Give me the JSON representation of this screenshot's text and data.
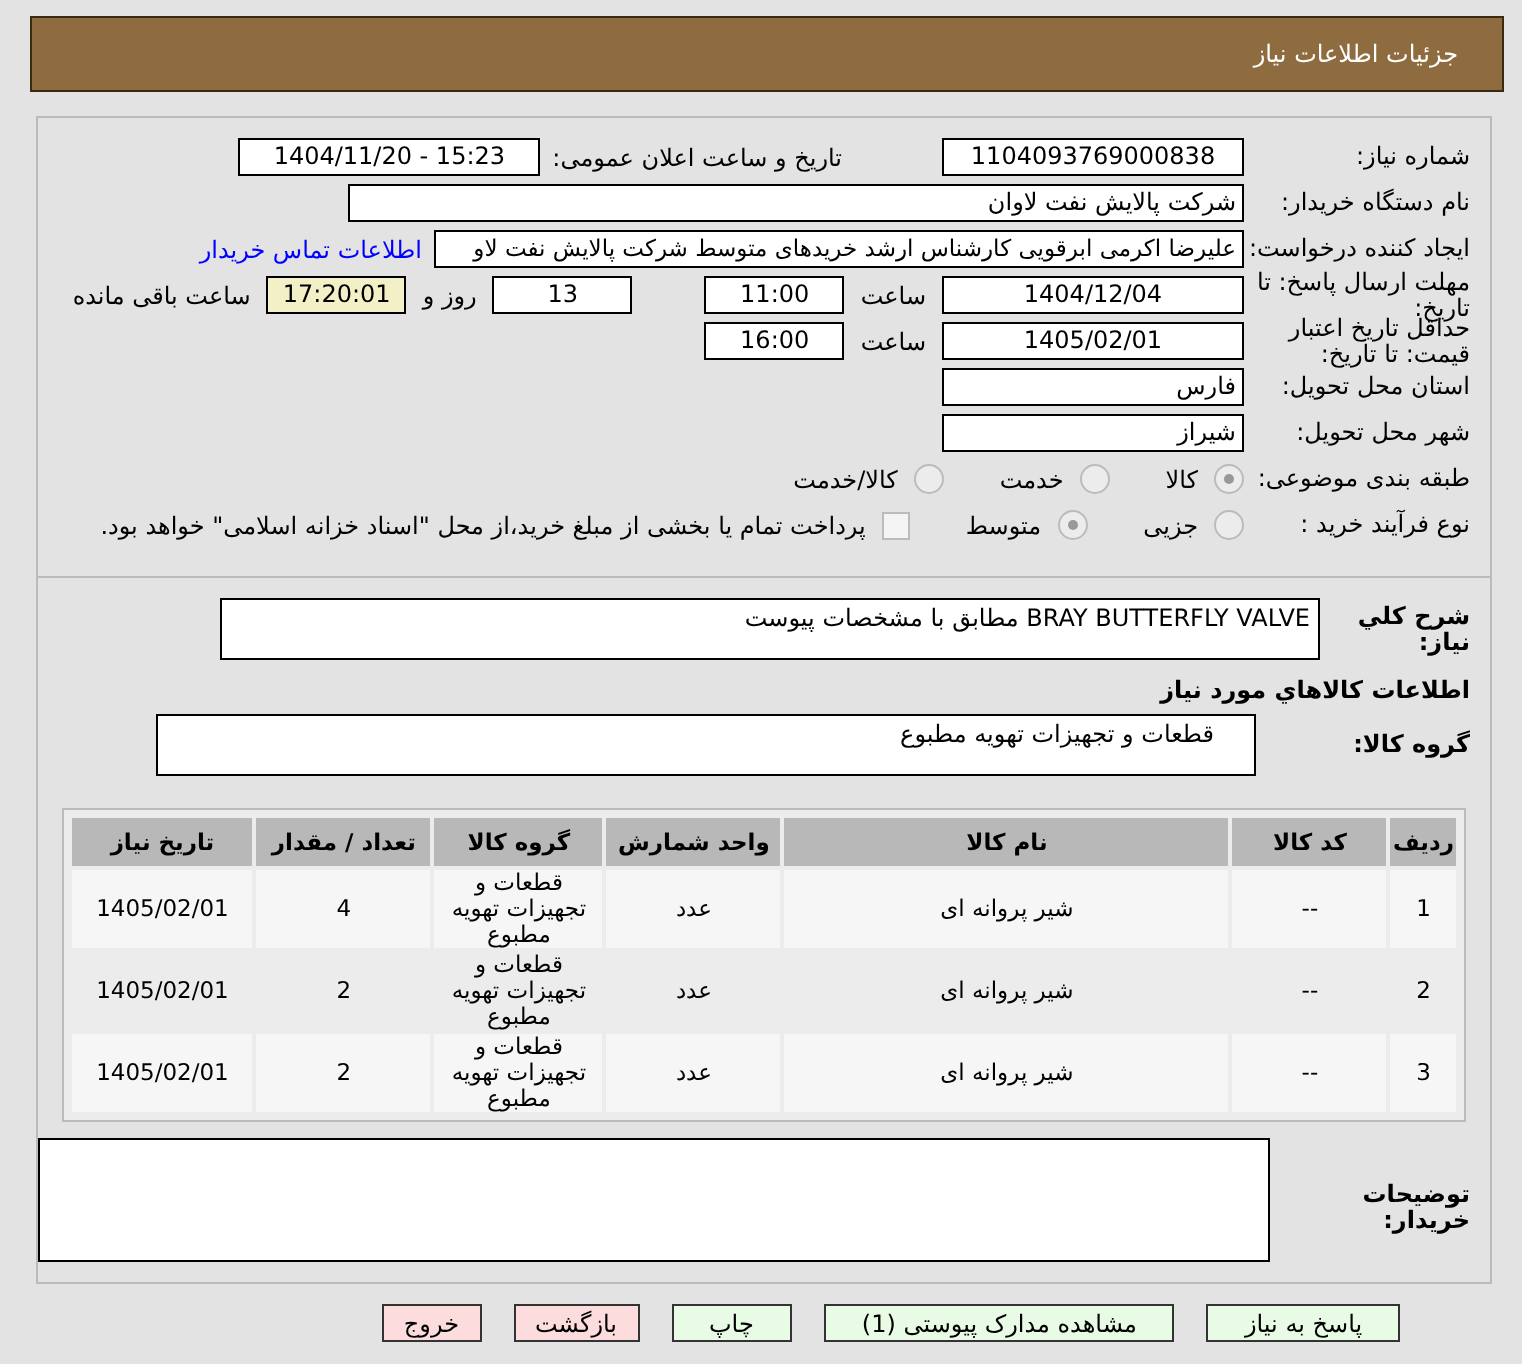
{
  "header": {
    "title": "جزئیات اطلاعات نیاز"
  },
  "form": {
    "need_number": {
      "label": "شماره نیاز:",
      "value": "1104093769000838"
    },
    "announce": {
      "label": "تاریخ و ساعت اعلان عمومی:",
      "value": "1404/11/20 - 15:23"
    },
    "buyer": {
      "label": "نام دستگاه خریدار:",
      "value": "شرکت پالایش نفت لاوان"
    },
    "creator": {
      "label": "ایجاد کننده درخواست:",
      "value": "علیرضا اکرمی ابرقویی کارشناس ارشد خریدهای متوسط شرکت پالایش نفت لاو",
      "link": "اطلاعات تماس خریدار"
    },
    "deadline": {
      "label": "مهلت ارسال پاسخ: تا تاریخ:",
      "date": "1404/12/04",
      "time_label": "ساعت",
      "time": "11:00",
      "days": "13",
      "days_label": "روز و",
      "remaining": "17:20:01",
      "remaining_label": "ساعت باقی مانده"
    },
    "validity": {
      "label": "حداقل تاریخ اعتبار قیمت: تا تاریخ:",
      "date": "1405/02/01",
      "time_label": "ساعت",
      "time": "16:00"
    },
    "province": {
      "label": "استان محل تحویل:",
      "value": "فارس"
    },
    "city": {
      "label": "شهر محل تحویل:",
      "value": "شیراز"
    },
    "category": {
      "label": "طبقه بندی موضوعی:",
      "options": [
        {
          "label": "کالا",
          "selected": true
        },
        {
          "label": "خدمت",
          "selected": false
        },
        {
          "label": "کالا/خدمت",
          "selected": false
        }
      ]
    },
    "process": {
      "label": "نوع فرآیند خرید :",
      "options": [
        {
          "label": "جزیی",
          "selected": false
        },
        {
          "label": "متوسط",
          "selected": true
        }
      ],
      "payment": {
        "label": "پرداخت تمام یا بخشی از مبلغ خرید،از محل \"اسناد خزانه اسلامی\" خواهد بود.",
        "checked": false
      }
    }
  },
  "description": {
    "label": "شرح کلي نياز:",
    "value": "BRAY BUTTERFLY VALVE مطابق با مشخصات پیوست"
  },
  "goods_title": "اطلاعات کالاهاي مورد نياز",
  "goods_group": {
    "label": "گروه کالا:",
    "value": "قطعات و تجهیزات تهویه مطبوع"
  },
  "table": {
    "columns": [
      "ردیف",
      "کد کالا",
      "نام کالا",
      "واحد شمارش",
      "گروه کالا",
      "تعداد / مقدار",
      "تاریخ نیاز"
    ],
    "rows": [
      [
        "1",
        "--",
        "شیر پروانه ای",
        "عدد",
        "قطعات و تجهیزات تهویه مطبوع",
        "4",
        "1405/02/01"
      ],
      [
        "2",
        "--",
        "شیر پروانه ای",
        "عدد",
        "قطعات و تجهیزات تهویه مطبوع",
        "2",
        "1405/02/01"
      ],
      [
        "3",
        "--",
        "شیر پروانه ای",
        "عدد",
        "قطعات و تجهیزات تهویه مطبوع",
        "2",
        "1405/02/01"
      ]
    ]
  },
  "notes": {
    "label": "توضیحات خریدار:"
  },
  "buttons": [
    {
      "label": "پاسخ به نیاز",
      "kind": "green"
    },
    {
      "label": "مشاهده مدارک پیوستی (1)",
      "kind": "green"
    },
    {
      "label": "چاپ",
      "kind": "green"
    },
    {
      "label": "بازگشت",
      "kind": "red"
    },
    {
      "label": "خروج",
      "kind": "red"
    }
  ]
}
